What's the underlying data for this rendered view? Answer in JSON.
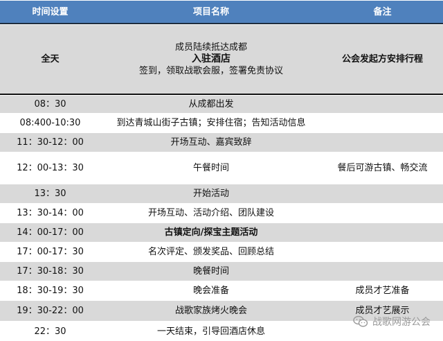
{
  "header": {
    "col_time": "时间设置",
    "col_item": "项目名称",
    "col_note": "备注"
  },
  "all_day": {
    "time": "全天",
    "lines": [
      "成员陆续抵达成都",
      "入驻酒店",
      "签到，领取战歌会服，签署免责协议"
    ],
    "note": "公会发起方安排行程"
  },
  "rows": [
    {
      "time": "08：30",
      "item": "从成都出发",
      "note": ""
    },
    {
      "time": "08:400-10:30",
      "item": "到达青城山街子古镇；安排住宿；告知活动信息",
      "note": ""
    },
    {
      "time": "11：30-12：00",
      "item": "开场互动、嘉宾致辞",
      "note": ""
    },
    {
      "time": "12：00-13：30",
      "item": "午餐时间",
      "note": "餐后可游古镇、畅交流"
    },
    {
      "time": "13：30",
      "item": "开始活动",
      "note": ""
    },
    {
      "time": "13：30-14：00",
      "item": "开场互动、活动介绍、团队建设",
      "note": ""
    },
    {
      "time": "14：00-17：00",
      "item": "古镇定向/探宝主题活动",
      "note": ""
    },
    {
      "time": "17：00-17：30",
      "item": "名次评定、颁发奖品、回顾总结",
      "note": ""
    },
    {
      "time": "17：30-18：30",
      "item": "晚餐时间",
      "note": ""
    },
    {
      "time": "18：30-19：30",
      "item": "晚会准备",
      "note": "成员才艺准备"
    },
    {
      "time": "19：30-22：00",
      "item": "战歌家族烤火晚会",
      "note": "成员才艺展示"
    },
    {
      "time": "22：30",
      "item": "一天结束，引导回酒店休息",
      "note": ""
    }
  ],
  "watermark": {
    "text": "战歌网游公会",
    "icon": "wechat-icon"
  }
}
